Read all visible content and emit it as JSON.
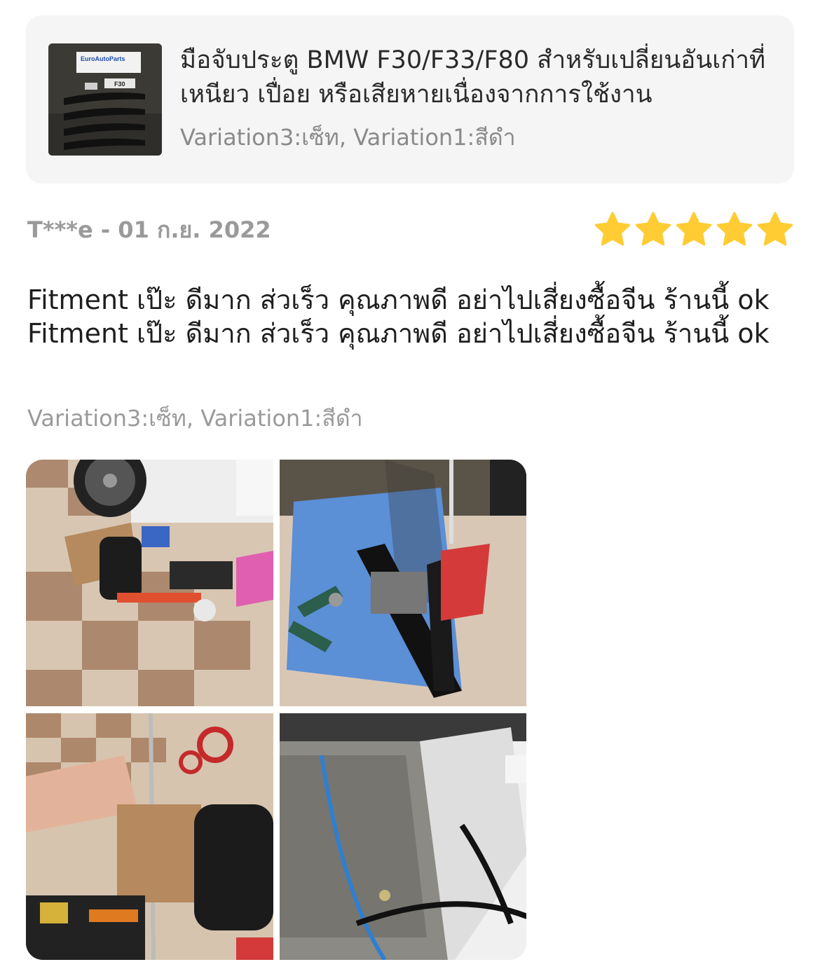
{
  "product": {
    "title": "มือจับประตู BMW F30/F33/F80 สำหรับเปลี่ยนอันเก่าที่เหนียว เปื่อย หรือเสียหายเนื่องจากการใช้งาน",
    "variation": "Variation3:เซ็ท, Variation1:สีดำ",
    "thumbnail_brand": "EuroAutoParts",
    "thumbnail_label": "F30"
  },
  "review": {
    "reviewer": "T***e",
    "separator": " - ",
    "date": "01 ก.ย. 2022",
    "rating": 5,
    "rating_max": 5,
    "text": "Fitment เป๊ะ ดีมาก ส่วเร็ว คุณภาพดี อย่าไปเสี่ยงซื้อจีน ร้านนี้ ok Fitment เป๊ะ ดีมาก ส่วเร็ว คุณภาพดี อย่าไปเสี่ยงซื้อจีน ร้านนี้ ok",
    "variation": "Variation3:เซ็ท, Variation1:สีดำ",
    "photos": [
      {
        "name": "review-photo-tools-floor"
      },
      {
        "name": "review-photo-door-handle-mechanism"
      },
      {
        "name": "review-photo-tool-case"
      },
      {
        "name": "review-photo-door-interior"
      }
    ]
  },
  "colors": {
    "star": "#FFCC33",
    "card_bg": "#F5F5F5",
    "muted_text": "#9A9A9A"
  },
  "icons": {
    "star": "star-icon"
  }
}
